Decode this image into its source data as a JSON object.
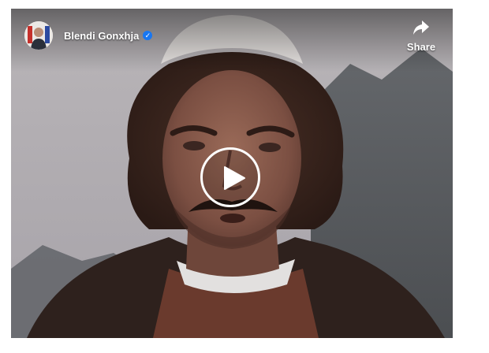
{
  "video": {
    "channel_name": "Blendi Gonxhja",
    "verified": "✓",
    "share_label": "Share",
    "icons": {
      "avatar": "avatar-image",
      "verified": "verified-badge-icon",
      "share": "share-arrow-icon",
      "play": "play-icon"
    },
    "colors": {
      "verified_badge": "#1877f2",
      "overlay_text": "#ffffff"
    }
  }
}
